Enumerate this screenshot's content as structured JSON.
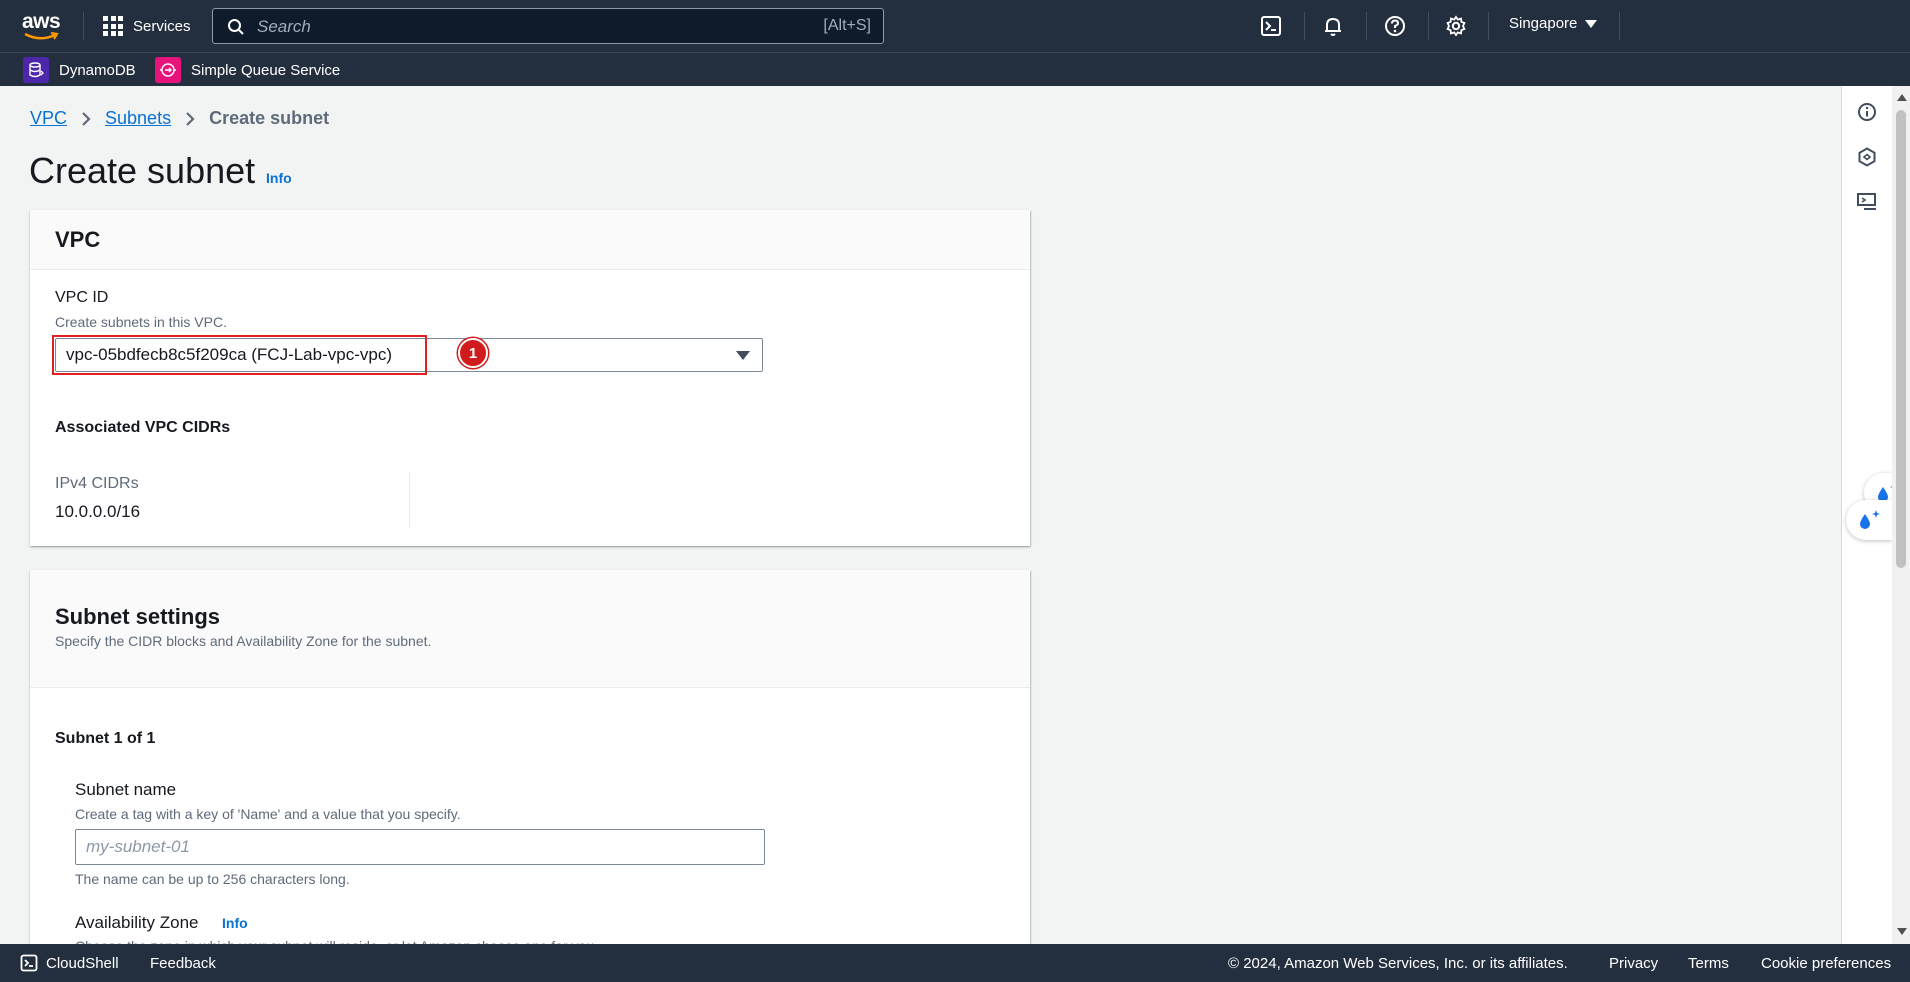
{
  "topnav": {
    "logo_text": "aws",
    "services_label": "Services",
    "search_placeholder": "Search",
    "search_shortcut": "[Alt+S]",
    "region": "Singapore",
    "icons": [
      "cloudshell-icon",
      "notifications-icon",
      "help-icon",
      "settings-icon"
    ]
  },
  "favorites": [
    {
      "label": "DynamoDB",
      "icon": "dynamodb-icon",
      "color": "#4d27aa"
    },
    {
      "label": "Simple Queue Service",
      "icon": "sqs-icon",
      "color": "#e7157b"
    }
  ],
  "breadcrumb": {
    "vpc": "VPC",
    "subnets": "Subnets",
    "current": "Create subnet"
  },
  "page": {
    "title": "Create subnet",
    "info": "Info"
  },
  "vpc_panel": {
    "title": "VPC",
    "vpc_id_label": "VPC ID",
    "vpc_id_desc": "Create subnets in this VPC.",
    "vpc_id_value": "vpc-05bdfecb8c5f209ca (FCJ-Lab-vpc-vpc)",
    "annotation_number": "1",
    "cidrs_heading": "Associated VPC CIDRs",
    "ipv4_label": "IPv4 CIDRs",
    "ipv4_value": "10.0.0.0/16"
  },
  "subnet_panel": {
    "title": "Subnet settings",
    "desc": "Specify the CIDR blocks and Availability Zone for the subnet.",
    "subnet_count": "Subnet 1 of 1",
    "name_label": "Subnet name",
    "name_desc": "Create a tag with a key of 'Name' and a value that you specify.",
    "name_placeholder": "my-subnet-01",
    "name_hint": "The name can be up to 256 characters long.",
    "az_label": "Availability Zone",
    "az_info": "Info",
    "az_desc": "Choose the zone in which your subnet will reside, or let Amazon choose one for you."
  },
  "footer": {
    "cloudshell": "CloudShell",
    "feedback": "Feedback",
    "copyright": "© 2024, Amazon Web Services, Inc. or its affiliates.",
    "privacy": "Privacy",
    "terms": "Terms",
    "cookies": "Cookie preferences"
  },
  "colors": {
    "nav_bg": "#232f3e",
    "link": "#0972d3",
    "highlight": "#e22020"
  }
}
